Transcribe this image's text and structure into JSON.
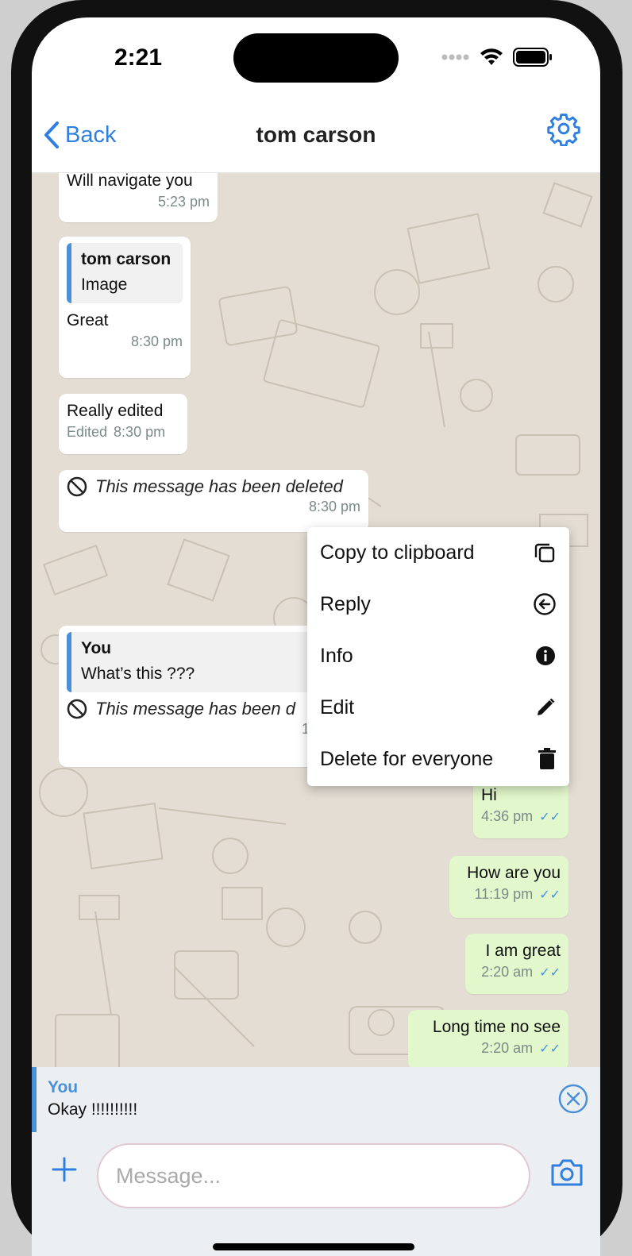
{
  "status": {
    "time": "2:21"
  },
  "nav": {
    "back_label": "Back",
    "title": "tom carson"
  },
  "messages": {
    "m1": {
      "text": "Will navigate you",
      "time": "5:23 pm"
    },
    "m2": {
      "quote_name": "tom carson",
      "quote_text": "Image",
      "text": "Great",
      "time": "8:30 pm"
    },
    "m3": {
      "text": "Really edited",
      "edited": "Edited",
      "time": "8:30 pm"
    },
    "m4": {
      "deleted_text": "This message has been deleted",
      "time": "8:30 pm"
    },
    "m5": {
      "quote_name": "You",
      "quote_text": "What’s this ???",
      "deleted_text": "This message has been d",
      "time": "10"
    },
    "m6": {
      "text": "Hi",
      "time": "4:36 pm"
    },
    "m7": {
      "text": "How are you",
      "time": "11:19 pm"
    },
    "m8": {
      "text": "I am great",
      "time": "2:20 am"
    },
    "m9": {
      "text": "Long time no see",
      "time": "2:20 am"
    }
  },
  "menu": {
    "items": [
      {
        "label": "Copy to clipboard",
        "icon": "copy-icon"
      },
      {
        "label": "Reply",
        "icon": "reply-icon"
      },
      {
        "label": "Info",
        "icon": "info-icon"
      },
      {
        "label": "Edit",
        "icon": "edit-icon"
      },
      {
        "label": "Delete for everyone",
        "icon": "trash-icon"
      }
    ]
  },
  "reply_preview": {
    "name": "You",
    "text": "Okay !!!!!!!!!!"
  },
  "composer": {
    "placeholder": "Message..."
  },
  "colors": {
    "accent": "#2f7fe0",
    "outgoing_bubble": "#e2f7cb",
    "reply_accent": "#4a90d9"
  }
}
